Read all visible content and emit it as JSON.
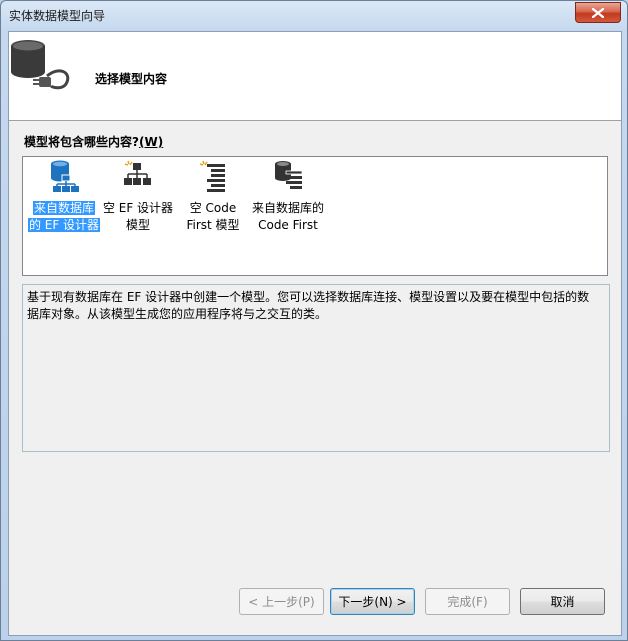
{
  "window": {
    "title": "实体数据模型向导"
  },
  "header": {
    "title": "选择模型内容"
  },
  "section": {
    "label": "模型将包含哪些内容?",
    "mnemonic": "(W)"
  },
  "model_types": [
    {
      "line1": "来自数据库",
      "line2": "的 EF 设计器",
      "icon": "database-hierarchy-icon",
      "selected": true
    },
    {
      "line1": "空 EF 设计器",
      "line2": "模型",
      "icon": "empty-hierarchy-icon",
      "selected": false
    },
    {
      "line1": "空 Code",
      "line2": "First 模型",
      "icon": "empty-code-first-icon",
      "selected": false
    },
    {
      "line1": "来自数据库的",
      "line2": "Code First",
      "icon": "database-code-first-icon",
      "selected": false
    }
  ],
  "description": "基于现有数据库在 EF 设计器中创建一个模型。您可以选择数据库连接、模型设置以及要在模型中包括的数据库对象。从该模型生成您的应用程序将与之交互的类。",
  "buttons": {
    "back": "< 上一步(P)",
    "next": "下一步(N) >",
    "finish": "完成(F)",
    "cancel": "取消"
  },
  "colors": {
    "selection": "#3399ff",
    "accent": "#1e73be"
  }
}
